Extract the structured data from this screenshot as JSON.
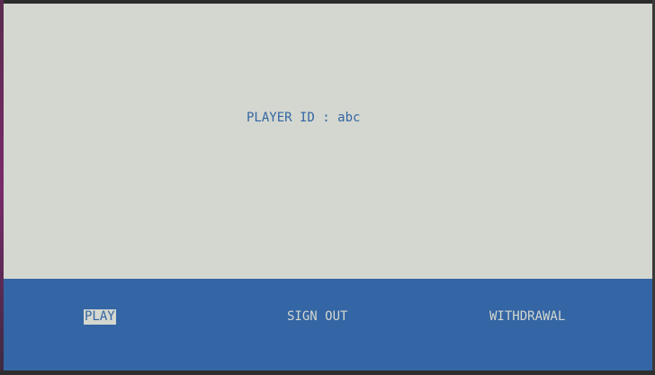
{
  "player": {
    "label": "PLAYER ID",
    "separator": " : ",
    "id": "abc"
  },
  "menu": {
    "items": [
      {
        "label": "PLAY",
        "selected": true
      },
      {
        "label": "SIGN OUT",
        "selected": false
      },
      {
        "label": "WITHDRAWAL",
        "selected": false
      }
    ]
  },
  "colors": {
    "background": "#d3d7cf",
    "accent": "#3465a4",
    "text_on_accent": "#d3d7cf"
  }
}
